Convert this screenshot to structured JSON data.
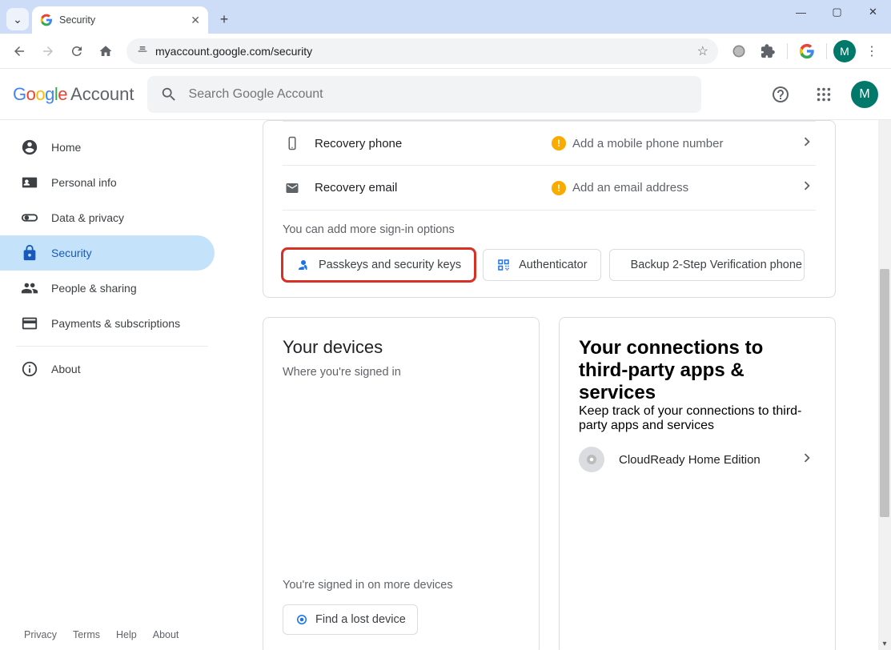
{
  "browser": {
    "tab_title": "Security",
    "url": "myaccount.google.com/security",
    "avatar_initial": "M"
  },
  "header": {
    "logo_google": "Google",
    "logo_account": "Account",
    "search_placeholder": "Search Google Account",
    "avatar_initial": "M"
  },
  "sidebar": {
    "items": [
      {
        "label": "Home"
      },
      {
        "label": "Personal info"
      },
      {
        "label": "Data & privacy"
      },
      {
        "label": "Security"
      },
      {
        "label": "People & sharing"
      },
      {
        "label": "Payments & subscriptions"
      },
      {
        "label": "About"
      }
    ]
  },
  "signin": {
    "recovery_phone_label": "Recovery phone",
    "recovery_phone_value": "Add a mobile phone number",
    "recovery_email_label": "Recovery email",
    "recovery_email_value": "Add an email address",
    "hint": "You can add more sign-in options",
    "chips": {
      "passkeys": "Passkeys and security keys",
      "authenticator": "Authenticator",
      "backup": "Backup 2-Step Verification phone"
    }
  },
  "devices": {
    "title": "Your devices",
    "subtitle": "Where you're signed in",
    "more": "You're signed in on more devices",
    "find_button": "Find a lost device"
  },
  "connections": {
    "title": "Your connections to third-party apps & services",
    "subtitle": "Keep track of your connections to third-party apps and services",
    "item": "CloudReady Home Edition"
  },
  "footer": {
    "privacy": "Privacy",
    "terms": "Terms",
    "help": "Help",
    "about": "About"
  }
}
